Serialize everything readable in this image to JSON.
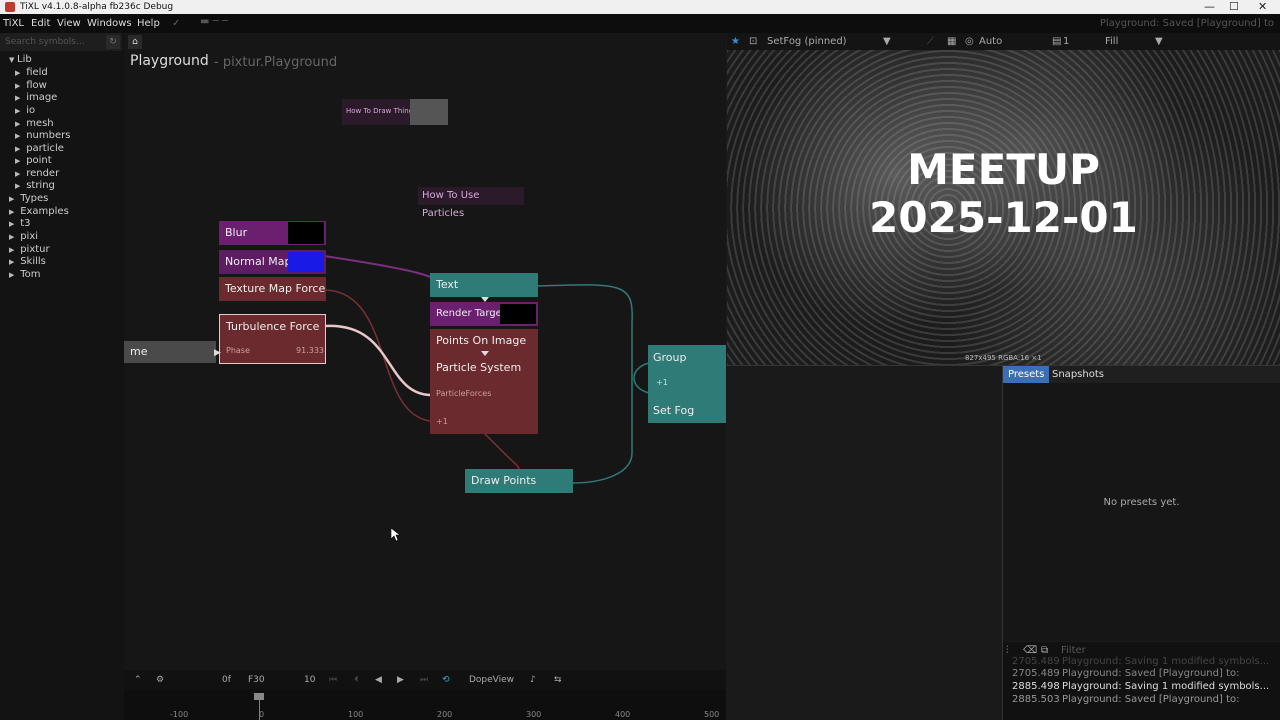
{
  "window": {
    "title": "TiXL v4.1.0.8-alpha fb236c Debug",
    "status": "Playground: Saved [Playground] to"
  },
  "menu": [
    "TiXL",
    "Edit",
    "View",
    "Windows",
    "Help"
  ],
  "library": {
    "search_placeholder": "Search symbols...",
    "items": [
      {
        "label": "Lib",
        "level": 0,
        "expanded": true
      },
      {
        "label": "field",
        "level": 1
      },
      {
        "label": "flow",
        "level": 1
      },
      {
        "label": "image",
        "level": 1
      },
      {
        "label": "io",
        "level": 1
      },
      {
        "label": "mesh",
        "level": 1
      },
      {
        "label": "numbers",
        "level": 1
      },
      {
        "label": "particle",
        "level": 1
      },
      {
        "label": "point",
        "level": 1
      },
      {
        "label": "render",
        "level": 1
      },
      {
        "label": "string",
        "level": 1
      },
      {
        "label": "Types",
        "level": 0
      },
      {
        "label": "Examples",
        "level": 0
      },
      {
        "label": "t3",
        "level": 0
      },
      {
        "label": "pixi",
        "level": 0
      },
      {
        "label": "pixtur",
        "level": 0
      },
      {
        "label": "Skills",
        "level": 0
      },
      {
        "label": "Tom",
        "level": 0
      }
    ]
  },
  "graph": {
    "title": "Playground",
    "subtitle": "- pixtur.Playground",
    "annotations": {
      "how_to_draw": "How To Draw Things",
      "how_to_particles": "How To Use Particles"
    },
    "nodes": {
      "blur": "Blur",
      "normal_map": "Normal Map",
      "texture_map_force": "Texture Map Force",
      "turbulence_force": "Turbulence Force",
      "phase_label": "Phase",
      "phase_value": "91.333",
      "time_partial": "me",
      "text": "Text",
      "render_target": "Render Target",
      "points_on_image": "Points On Image",
      "particle_system": "Particle System",
      "particle_forces": "ParticleForces",
      "plus_one": "+1",
      "draw_points": "Draw Points",
      "group": "Group",
      "group_plus": "+1",
      "set_fog": "Set Fog"
    }
  },
  "transport": {
    "frame": "0f",
    "fps": "F30",
    "value": "10",
    "dope_view": "DopeView"
  },
  "timeline": {
    "ticks": [
      "-100",
      "0",
      "100",
      "200",
      "300",
      "400",
      "500"
    ]
  },
  "viewer": {
    "pinned": "SetFog (pinned)",
    "auto": "Auto",
    "count": "1",
    "fill": "Fill",
    "overlay_line1": "MEETUP",
    "overlay_line2": "2025-12-01",
    "resolution": "827x495 RGBA:16 ×1"
  },
  "presets": {
    "tab_presets": "Presets",
    "tab_snapshots": "Snapshots",
    "empty": "No presets yet."
  },
  "log": {
    "filter_placeholder": "Filter",
    "lines": [
      {
        "ts": "2705.489",
        "msg": "Playground: Saving 1 modified symbols..."
      },
      {
        "ts": "2705.489",
        "msg": "Playground: Saved [Playground] to:"
      },
      {
        "ts": "2885.498",
        "msg": "Playground: Saving 1 modified symbols..."
      },
      {
        "ts": "2885.503",
        "msg": "Playground: Saved [Playground] to:"
      }
    ]
  },
  "colors": {
    "purple": "#6a1f6f",
    "red_node": "#6b2a2e",
    "teal_node": "#2f7b78",
    "accent": "#3a6fb5"
  }
}
